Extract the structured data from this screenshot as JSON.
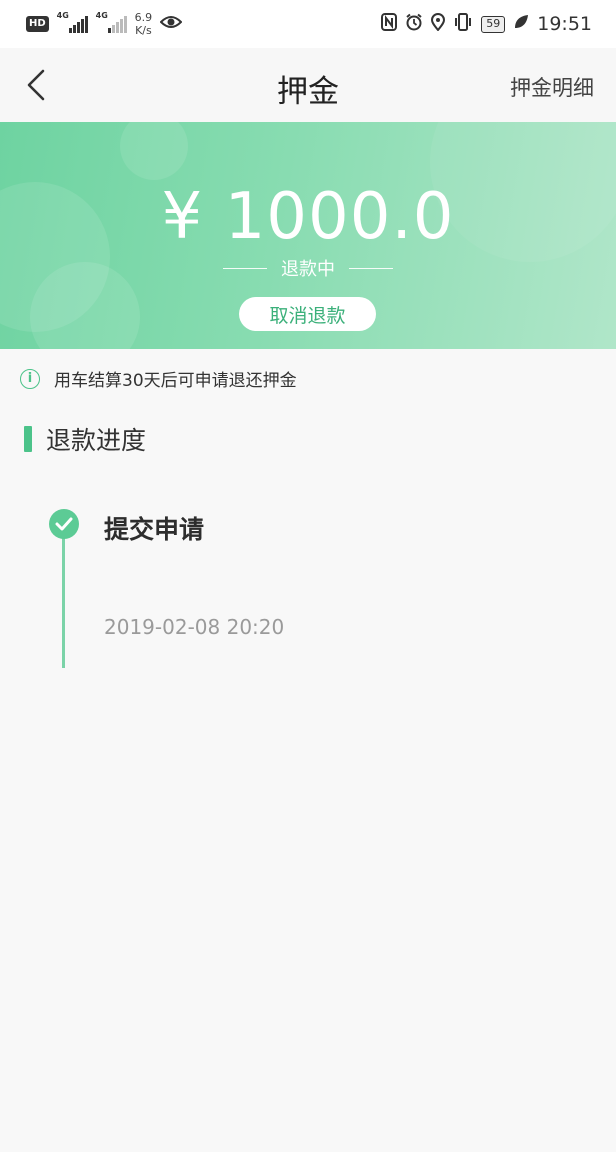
{
  "status_bar": {
    "hd_badge": "HD",
    "network1": "4G",
    "network2": "4G",
    "speed_value": "6.9",
    "speed_unit": "K/s",
    "battery": "59",
    "time": "19:51"
  },
  "nav": {
    "title": "押金",
    "detail_link": "押金明细"
  },
  "banner": {
    "amount": "¥ 1000.0",
    "status": "退款中",
    "cancel_button": "取消退款"
  },
  "notice": {
    "icon_glyph": "i",
    "text": "用车结算30天后可申请退还押金"
  },
  "progress": {
    "section_title": "退款进度",
    "steps": [
      {
        "title": "提交申请",
        "time": "2019-02-08 20:20"
      }
    ]
  },
  "colors": {
    "accent": "#4cc38a",
    "banner_start": "#6ed3a1",
    "banner_end": "#b0e6c9"
  }
}
